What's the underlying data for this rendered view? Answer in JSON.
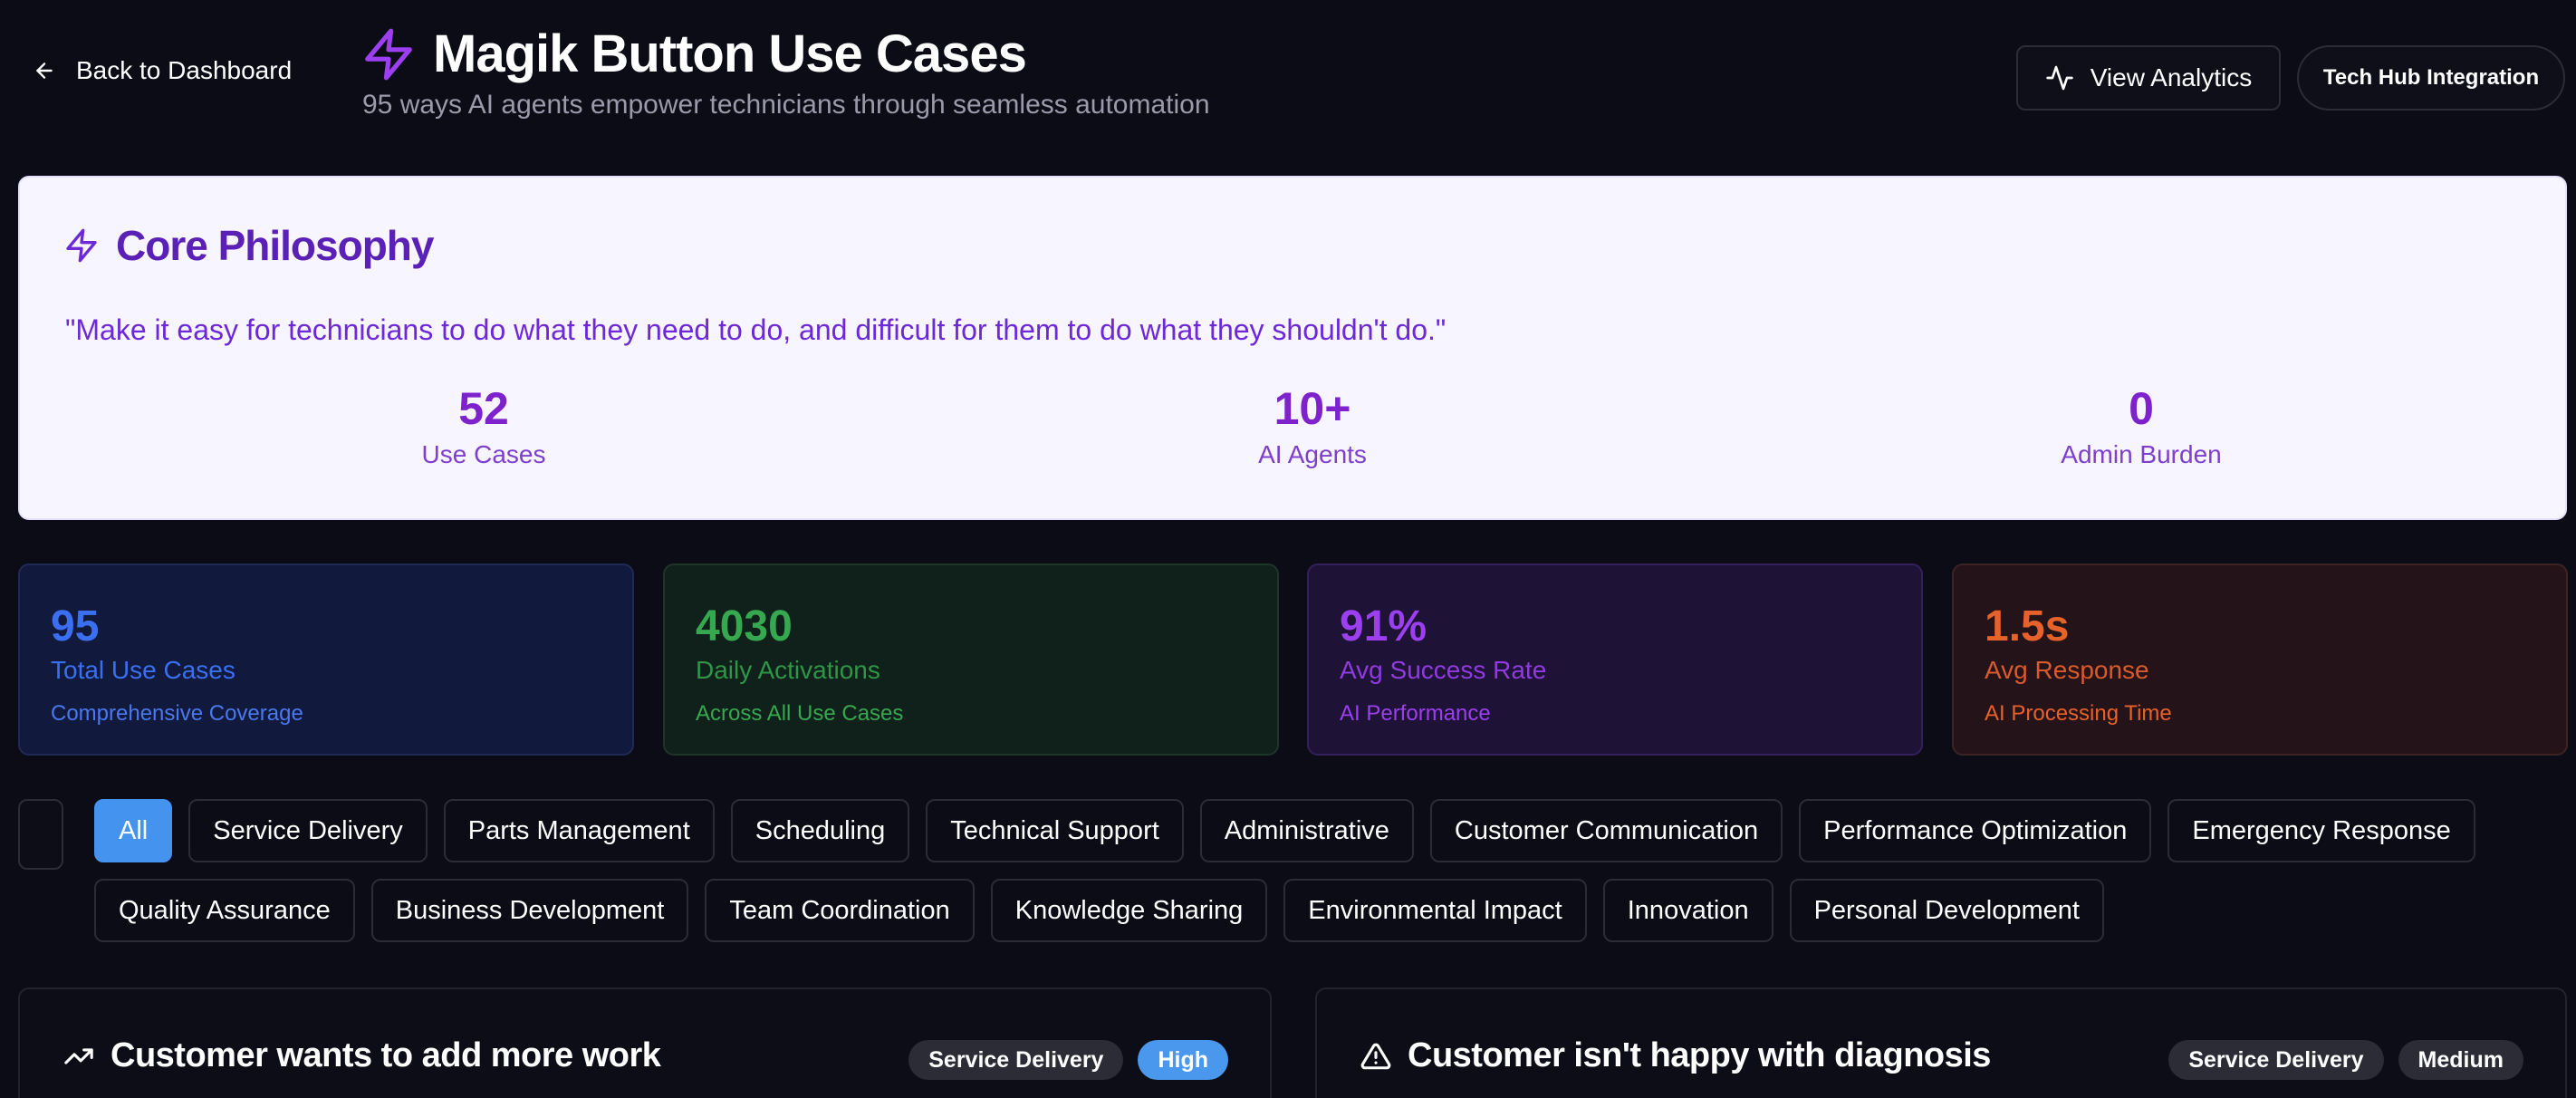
{
  "header": {
    "back_label": "Back to Dashboard",
    "title": "Magik Button Use Cases",
    "subtitle": "95 ways AI agents empower technicians through seamless automation",
    "analytics_label": "View Analytics",
    "techhub_label": "Tech Hub Integration"
  },
  "philosophy": {
    "title": "Core Philosophy",
    "quote": "\"Make it easy for technicians to do what they need to do, and difficult for them to do what they shouldn't do.\"",
    "stats": [
      {
        "value": "52",
        "label": "Use Cases"
      },
      {
        "value": "10+",
        "label": "AI Agents"
      },
      {
        "value": "0",
        "label": "Admin Burden"
      }
    ]
  },
  "metrics": [
    {
      "value": "95",
      "label": "Total Use Cases",
      "sub": "Comprehensive Coverage",
      "color": "#3b6ff2"
    },
    {
      "value": "4030",
      "label": "Daily Activations",
      "sub": "Across All Use Cases",
      "color": "#36a84f"
    },
    {
      "value": "91%",
      "label": "Avg Success Rate",
      "sub": "AI Performance",
      "color": "#9b3ff0"
    },
    {
      "value": "1.5s",
      "label": "Avg Response",
      "sub": "AI Processing Time",
      "color": "#e7612a"
    }
  ],
  "filters": [
    "All",
    "Service Delivery",
    "Parts Management",
    "Scheduling",
    "Technical Support",
    "Administrative",
    "Customer Communication",
    "Performance Optimization",
    "Emergency Response",
    "Quality Assurance",
    "Business Development",
    "Team Coordination",
    "Knowledge Sharing",
    "Environmental Impact",
    "Innovation",
    "Personal Development"
  ],
  "active_filter": "All",
  "use_cases": [
    {
      "title": "Customer wants to add more work",
      "category": "Service Delivery",
      "priority": "High",
      "icon": "trending-up-icon"
    },
    {
      "title": "Customer isn't happy with diagnosis",
      "category": "Service Delivery",
      "priority": "Medium",
      "icon": "warning-triangle-icon"
    }
  ],
  "colors": {
    "background": "#0b0c16",
    "accent": "#4493ee",
    "philosophy_text": "#6d28d9",
    "bolt": "#9b3ff0"
  }
}
